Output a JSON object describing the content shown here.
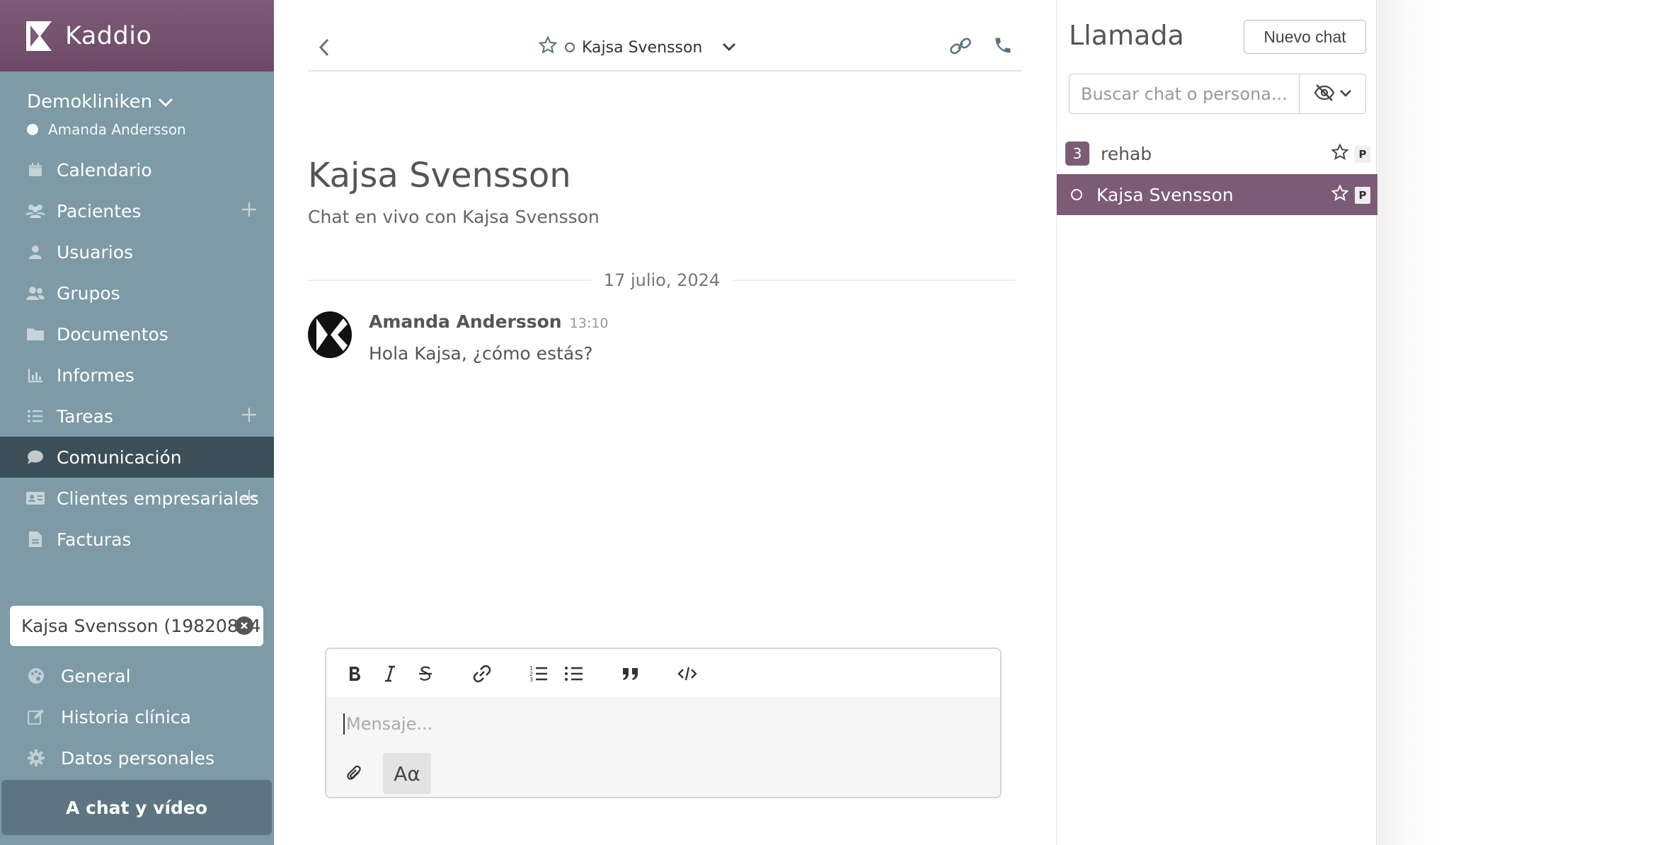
{
  "brand": {
    "name": "Kaddio"
  },
  "clinic": {
    "name": "Demokliniken",
    "user": "Amanda Andersson"
  },
  "nav": [
    {
      "label": "Calendario",
      "icon": "calendar-icon",
      "plus": false,
      "active": false
    },
    {
      "label": "Pacientes",
      "icon": "users-icon",
      "plus": true,
      "active": false
    },
    {
      "label": "Usuarios",
      "icon": "user-icon",
      "plus": false,
      "active": false
    },
    {
      "label": "Grupos",
      "icon": "group-icon",
      "plus": false,
      "active": false
    },
    {
      "label": "Documentos",
      "icon": "folder-icon",
      "plus": false,
      "active": false
    },
    {
      "label": "Informes",
      "icon": "chart-icon",
      "plus": false,
      "active": false
    },
    {
      "label": "Tareas",
      "icon": "list-icon",
      "plus": true,
      "active": false
    },
    {
      "label": "Comunicación",
      "icon": "chat-icon",
      "plus": false,
      "active": true
    },
    {
      "label": "Clientes empresariales",
      "icon": "id-card-icon",
      "plus": true,
      "active": false
    },
    {
      "label": "Facturas",
      "icon": "file-icon",
      "plus": false,
      "active": false
    }
  ],
  "patient_box": {
    "value": "Kajsa Svensson (19820814"
  },
  "sub_nav": [
    {
      "label": "General",
      "icon": "palette-icon"
    },
    {
      "label": "Historia clínica",
      "icon": "edit-icon"
    },
    {
      "label": "Datos personales",
      "icon": "gear-icon"
    }
  ],
  "chat_video_button": "A chat y vídeo",
  "chat": {
    "header_name": "Kajsa Svensson",
    "title": "Kajsa Svensson",
    "subtitle": "Chat en vivo con Kajsa Svensson",
    "date_separator": "17 julio, 2024",
    "messages": [
      {
        "author": "Amanda Andersson",
        "time": "13:10",
        "text": "Hola Kajsa, ¿cómo estás?"
      }
    ],
    "composer_placeholder": "Mensaje...",
    "format_label": "Aα"
  },
  "right_panel": {
    "title": "Llamada",
    "new_chat_label": "Nuevo chat",
    "search_placeholder": "Buscar chat o persona...",
    "chats": [
      {
        "count": "3",
        "name": "rehab",
        "badge": "P",
        "selected": false
      },
      {
        "count": "",
        "name": "Kajsa Svensson",
        "badge": "P",
        "selected": true
      }
    ]
  },
  "colors": {
    "brand_purple": "#7e5a76",
    "sidebar": "#7d9aa6",
    "sidebar_active": "#3c4f58",
    "selected_row": "#7c5b76"
  }
}
